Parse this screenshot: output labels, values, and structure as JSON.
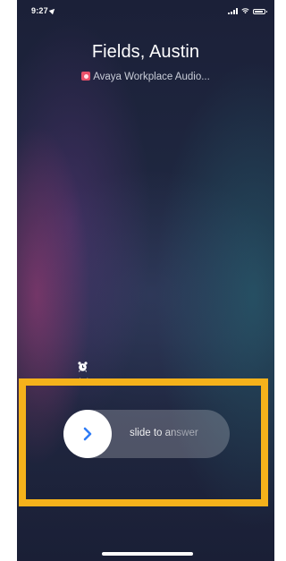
{
  "status_bar": {
    "time": "9:27",
    "location_icon": "location-arrow-icon",
    "signal_icon": "cellular-signal-icon",
    "wifi_icon": "wifi-icon",
    "battery_icon": "battery-icon",
    "battery_level": 0.85
  },
  "call": {
    "caller_name": "Fields, Austin",
    "app_icon": "avaya-app-icon",
    "subtitle": "Avaya Workplace Audio..."
  },
  "actions": {
    "remind_me": {
      "icon": "alarm-clock-icon",
      "label": "Remind Me"
    }
  },
  "slider": {
    "knob_icon": "chevron-right-icon",
    "knob_icon_color": "#2f7cf6",
    "label": "slide to answer"
  },
  "highlight": {
    "color": "#f5b21b"
  }
}
